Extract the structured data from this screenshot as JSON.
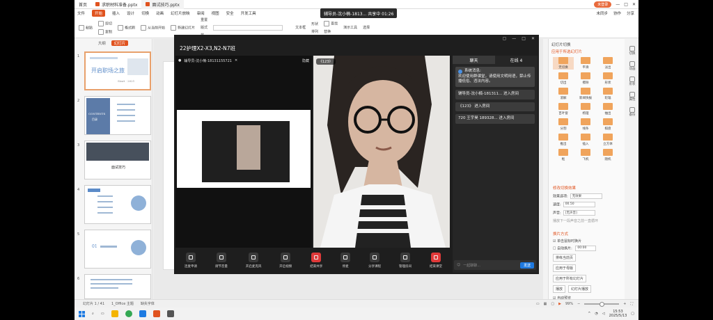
{
  "titlebar": {
    "home_tab": "首页",
    "tab1": "求职材料准备.pptx",
    "tab2": "面试技巧.pptx",
    "right_user": "未登录",
    "right_note": "未同步",
    "right_share": "分享"
  },
  "share_badge": "辅导员-沈小楠-1813... 共享中 01:26",
  "menubar": {
    "file": "文件",
    "items": [
      "开始",
      "插入",
      "设计",
      "切换",
      "动画",
      "幻灯片放映",
      "审阅",
      "视图",
      "安全",
      "开发工具"
    ],
    "right": [
      "协作",
      "分享"
    ]
  },
  "ribbon": {
    "paste": "粘贴",
    "cut": "剪切",
    "copy": "复制",
    "format": "格式刷",
    "from_start": "从当前开始",
    "new_slide": "新建幻灯片",
    "layout": "版式",
    "reset": "重置",
    "section": "节",
    "textbox": "文本框",
    "shape": "形状",
    "arrange": "排列",
    "find": "查找",
    "replace": "替换",
    "select": "选择",
    "presenter": "演示工具"
  },
  "left_panel": {
    "tab_outline": "大纲",
    "tab_slides": "幻灯片",
    "slides": [
      {
        "num": "1",
        "title": "开启职场之旅",
        "sub": "Start · 2021"
      },
      {
        "num": "2",
        "title": "CONTENTS",
        "sub": "目录"
      },
      {
        "num": "3",
        "title": "面试技巧",
        "sub": ""
      },
      {
        "num": "4",
        "title": "",
        "sub": ""
      },
      {
        "num": "5",
        "title": "01",
        "sub": ""
      },
      {
        "num": "6",
        "title": "",
        "sub": ""
      }
    ]
  },
  "meeting": {
    "title": "22护理X2-X3,N2-N7班",
    "left_user": "辅导员-沈小楠-18131155721",
    "left_right": "隐藏",
    "right_badge": "《123》",
    "chat_tab": "聊天",
    "online_tab": "在线 4",
    "system_title": "系统消息:",
    "system_text": "欢迎使用群课堂，请使用文明用语，禁止传播低俗、违法内容。",
    "msgs": [
      "辅导员-沈小楠-181311... 进入房间",
      "《123》 进入房间",
      "720 王宇昊 189328... 进入房间"
    ],
    "chat_placeholder": "一起聊聊...",
    "send": "发送",
    "controls": [
      "连麦申请",
      "调节音量",
      "开启麦克风",
      "开启视频",
      "结束共享",
      "停麦",
      "分享课程",
      "管理房间",
      "结束课堂"
    ]
  },
  "right_panel": {
    "title": "幻灯片切换",
    "sub": "应用于所选幻灯片",
    "transitions": [
      "无切换",
      "平滑",
      "淡出",
      "切出",
      "擦除",
      "形状",
      "溶解",
      "新闻快报",
      "轮辐",
      "百叶窗",
      "梳理",
      "抽出",
      "分割",
      "线条",
      "棋盘",
      "推出",
      "插入",
      "立方体",
      "框",
      "飞机",
      "随机"
    ],
    "modify_head": "修改切换效果",
    "effect_label": "效果选项:",
    "effect_value": "无效果",
    "speed_label": "速度:",
    "speed_value": "00.50",
    "sound_label": "声音:",
    "sound_value": "[无声音]",
    "loop": "播放下一段声音之前一直循环",
    "switch_head": "换片方式",
    "on_click": "单击鼠标时换片",
    "auto": "自动换片:",
    "auto_value": "00:00",
    "sort": "排练当前页",
    "apply_master": "应用于母版",
    "apply_all": "应用于所有幻灯片",
    "play": "播放",
    "slideshow": "幻灯片播放",
    "auto_preview": "自动预览"
  },
  "side_icons": [
    "切换",
    "动画",
    "形状",
    "属性",
    "备份"
  ],
  "statusbar": {
    "slide": "幻灯片 1 / 41",
    "theme": "1_Office 主题",
    "font": "缺失字体",
    "zoom": "99%"
  },
  "taskbar": {
    "time": "15:53",
    "date": "2025/5/13"
  },
  "colors": {
    "accent": "#e0531f",
    "send_blue": "#1f7ae0",
    "end_red": "#e03a3a"
  }
}
